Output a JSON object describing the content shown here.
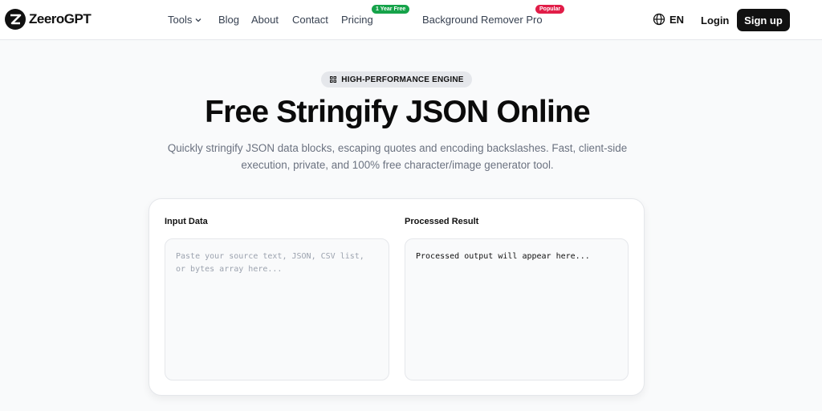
{
  "header": {
    "logo_text": "ZeeroGPT",
    "nav": [
      {
        "label": "Tools"
      },
      {
        "label": "Blog"
      },
      {
        "label": "About"
      },
      {
        "label": "Contact"
      },
      {
        "label": "Pricing",
        "badge": "1 Year Free"
      },
      {
        "label": "Background Remover Pro",
        "badge": "Popular"
      }
    ],
    "language": "EN",
    "login_label": "Login",
    "signup_label": "Sign up"
  },
  "hero": {
    "pill_text": "HIGH-PERFORMANCE ENGINE",
    "title": "Free Stringify JSON Online",
    "subtitle": "Quickly stringify JSON data blocks, escaping quotes and encoding backslashes. Fast, client-side execution, private, and 100% free character/image generator tool."
  },
  "tool": {
    "input_label": "Input Data",
    "input_value": "",
    "input_placeholder": "Paste your source text, JSON, CSV list, or bytes array here...",
    "output_label": "Processed Result",
    "output_text": "Processed output will appear here..."
  },
  "icons": {
    "logo": "zeerogpt-logo-icon",
    "tools_dropdown": "chevron-down-icon",
    "language": "globe-icon",
    "pill": "lightning-icon"
  },
  "colors": {
    "brand_dark": "#111111",
    "badge_green": "#16a34a",
    "badge_red": "#e11d48",
    "muted_text": "#6b7280"
  }
}
